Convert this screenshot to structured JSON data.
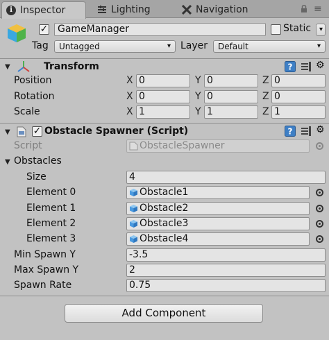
{
  "tabs": [
    {
      "label": "Inspector",
      "icon": "info-icon",
      "active": true
    },
    {
      "label": "Lighting",
      "icon": "lighting-icon",
      "active": false
    },
    {
      "label": "Navigation",
      "icon": "navigation-icon",
      "active": false
    }
  ],
  "header": {
    "name": "GameManager",
    "active": true,
    "static_label": "Static",
    "static_checked": false,
    "tag_label": "Tag",
    "tag_value": "Untagged",
    "layer_label": "Layer",
    "layer_value": "Default"
  },
  "transform": {
    "title": "Transform",
    "rows": [
      {
        "label": "Position",
        "x": "0",
        "y": "0",
        "z": "0"
      },
      {
        "label": "Rotation",
        "x": "0",
        "y": "0",
        "z": "0"
      },
      {
        "label": "Scale",
        "x": "1",
        "y": "1",
        "z": "1"
      }
    ],
    "axis_labels": [
      "X",
      "Y",
      "Z"
    ]
  },
  "script_component": {
    "title": "Obstacle Spawner (Script)",
    "enabled": true,
    "script_label": "Script",
    "script_value": "ObstacleSpawner",
    "obstacles_label": "Obstacles",
    "size_label": "Size",
    "size_value": "4",
    "elements": [
      {
        "label": "Element 0",
        "value": "Obstacle1"
      },
      {
        "label": "Element 1",
        "value": "Obstacle2"
      },
      {
        "label": "Element 2",
        "value": "Obstacle3"
      },
      {
        "label": "Element 3",
        "value": "Obstacle4"
      }
    ],
    "min_spawn_label": "Min Spawn Y",
    "min_spawn_value": "-3.5",
    "max_spawn_label": "Max Spawn Y",
    "max_spawn_value": "2",
    "spawn_rate_label": "Spawn Rate",
    "spawn_rate_value": "0.75"
  },
  "add_component_label": "Add Component",
  "colors": {
    "panel": "#c2c2c2",
    "tabbar": "#a5a5a5",
    "help_icon_blue": "#3e7fc5",
    "cube_blue": "#4a9ae0"
  }
}
